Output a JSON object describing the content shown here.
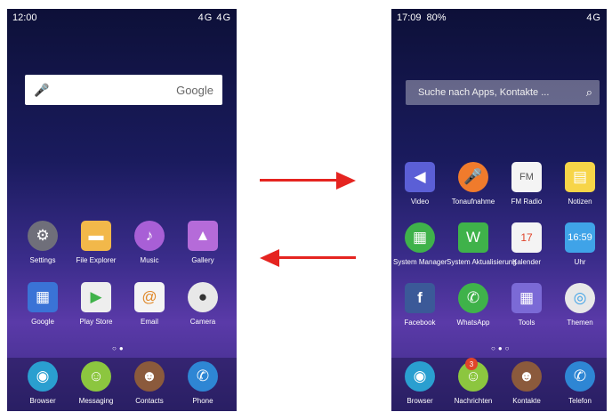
{
  "left_phone": {
    "status": {
      "time": "12:00",
      "network": "4G 4G"
    },
    "search_placeholder": "Google",
    "apps_row1": [
      {
        "label": "Settings",
        "icon": "gear-icon",
        "color": "#6f6f7a"
      },
      {
        "label": "File Explorer",
        "icon": "folder-icon",
        "color": "#f2b84a"
      },
      {
        "label": "Music",
        "icon": "music-icon",
        "color": "#a85fd6"
      },
      {
        "label": "Gallery",
        "icon": "gallery-icon",
        "color": "#b56bd9"
      }
    ],
    "apps_row2": [
      {
        "label": "Google",
        "icon": "google-folder-icon",
        "color": "#3a73d6"
      },
      {
        "label": "Play Store",
        "icon": "play-store-icon",
        "color": "#eeeeee"
      },
      {
        "label": "Email",
        "icon": "email-icon",
        "color": "#f4f4f4"
      },
      {
        "label": "Camera",
        "icon": "camera-icon",
        "color": "#e8e8e8"
      }
    ],
    "dock": [
      {
        "label": "Browser",
        "icon": "browser-icon",
        "color": "#2a9fd0"
      },
      {
        "label": "Messaging",
        "icon": "messaging-icon",
        "color": "#8cc63f"
      },
      {
        "label": "Contacts",
        "icon": "contacts-icon",
        "color": "#8b5a3c"
      },
      {
        "label": "Phone",
        "icon": "phone-icon",
        "color": "#2e86d4"
      }
    ]
  },
  "right_phone": {
    "status": {
      "time": "17:09",
      "battery": "80%",
      "network": "4G"
    },
    "search_placeholder": "Suche nach Apps, Kontakte ...",
    "apps_row1": [
      {
        "label": "Video",
        "icon": "video-icon",
        "color": "#5b5fd6"
      },
      {
        "label": "Tonaufnahme",
        "icon": "recorder-icon",
        "color": "#f07b2c"
      },
      {
        "label": "FM Radio",
        "icon": "radio-icon",
        "color": "#f4f4f4"
      },
      {
        "label": "Notizen",
        "icon": "notes-icon",
        "color": "#f7d548"
      }
    ],
    "apps_row2": [
      {
        "label": "System Manager",
        "icon": "system-manager-icon",
        "color": "#3fb24a"
      },
      {
        "label": "System Aktualisierung",
        "icon": "system-update-icon",
        "color": "#3fb24a"
      },
      {
        "label": "Kalender",
        "icon": "calendar-icon",
        "color": "#f4f4f4"
      },
      {
        "label": "Uhr",
        "icon": "clock-icon",
        "color": "#3fa3e8"
      }
    ],
    "apps_row3": [
      {
        "label": "Facebook",
        "icon": "facebook-icon",
        "color": "#3b5998"
      },
      {
        "label": "WhatsApp",
        "icon": "whatsapp-icon",
        "color": "#3fb24a"
      },
      {
        "label": "Tools",
        "icon": "tools-folder-icon",
        "color": "#7b6ad6"
      },
      {
        "label": "Themen",
        "icon": "themes-icon",
        "color": "#e8e8e8"
      }
    ],
    "dock": [
      {
        "label": "Browser",
        "icon": "browser-icon",
        "color": "#2a9fd0"
      },
      {
        "label": "Nachrichten",
        "icon": "messaging-icon",
        "color": "#8cc63f",
        "badge": "3"
      },
      {
        "label": "Kontakte",
        "icon": "contacts-icon",
        "color": "#8b5a3c"
      },
      {
        "label": "Telefon",
        "icon": "phone-icon",
        "color": "#2e86d4"
      }
    ]
  },
  "colors": {
    "arrow": "#e52420"
  }
}
